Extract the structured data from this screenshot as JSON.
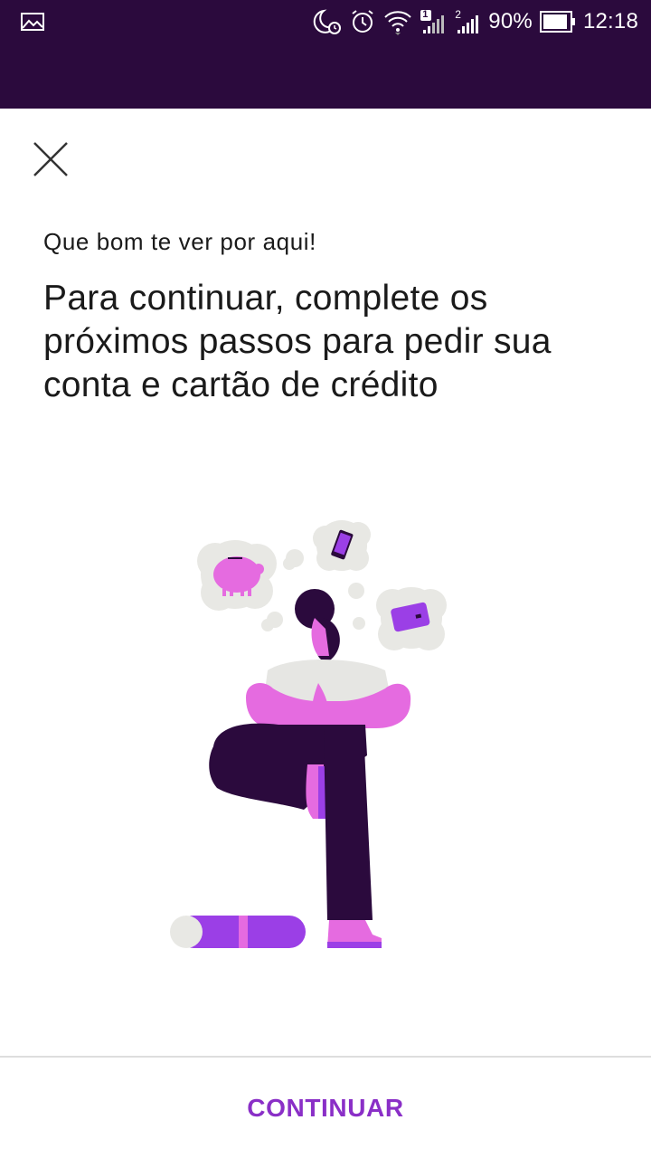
{
  "status_bar": {
    "notification_icon": "image-icon",
    "moon_icon": "do-not-disturb-icon",
    "alarm_icon": "alarm-clock-icon",
    "wifi_icon": "wifi-icon",
    "sim1_badge": "1",
    "sim2_badge": "2",
    "battery_percent": "90%",
    "time": "12:18"
  },
  "header": {
    "close_icon": "close-icon"
  },
  "content": {
    "greeting": "Que bom te ver por aqui!",
    "headline": "Para continuar, complete os próximos passos para pedir sua conta e cartão de crédito"
  },
  "illustration": {
    "name": "yoga-person-illustration",
    "items": [
      "piggy-bank-icon",
      "smartphone-icon",
      "credit-card-icon"
    ]
  },
  "footer": {
    "continue_label": "CONTINUAR"
  },
  "colors": {
    "status_bar_bg": "#2b0a3d",
    "accent": "#8a2fc7",
    "dark_purple": "#2b0a3d",
    "pink": "#e56be0",
    "violet": "#9b3fe6",
    "cloud_gray": "#e6e6e3"
  }
}
